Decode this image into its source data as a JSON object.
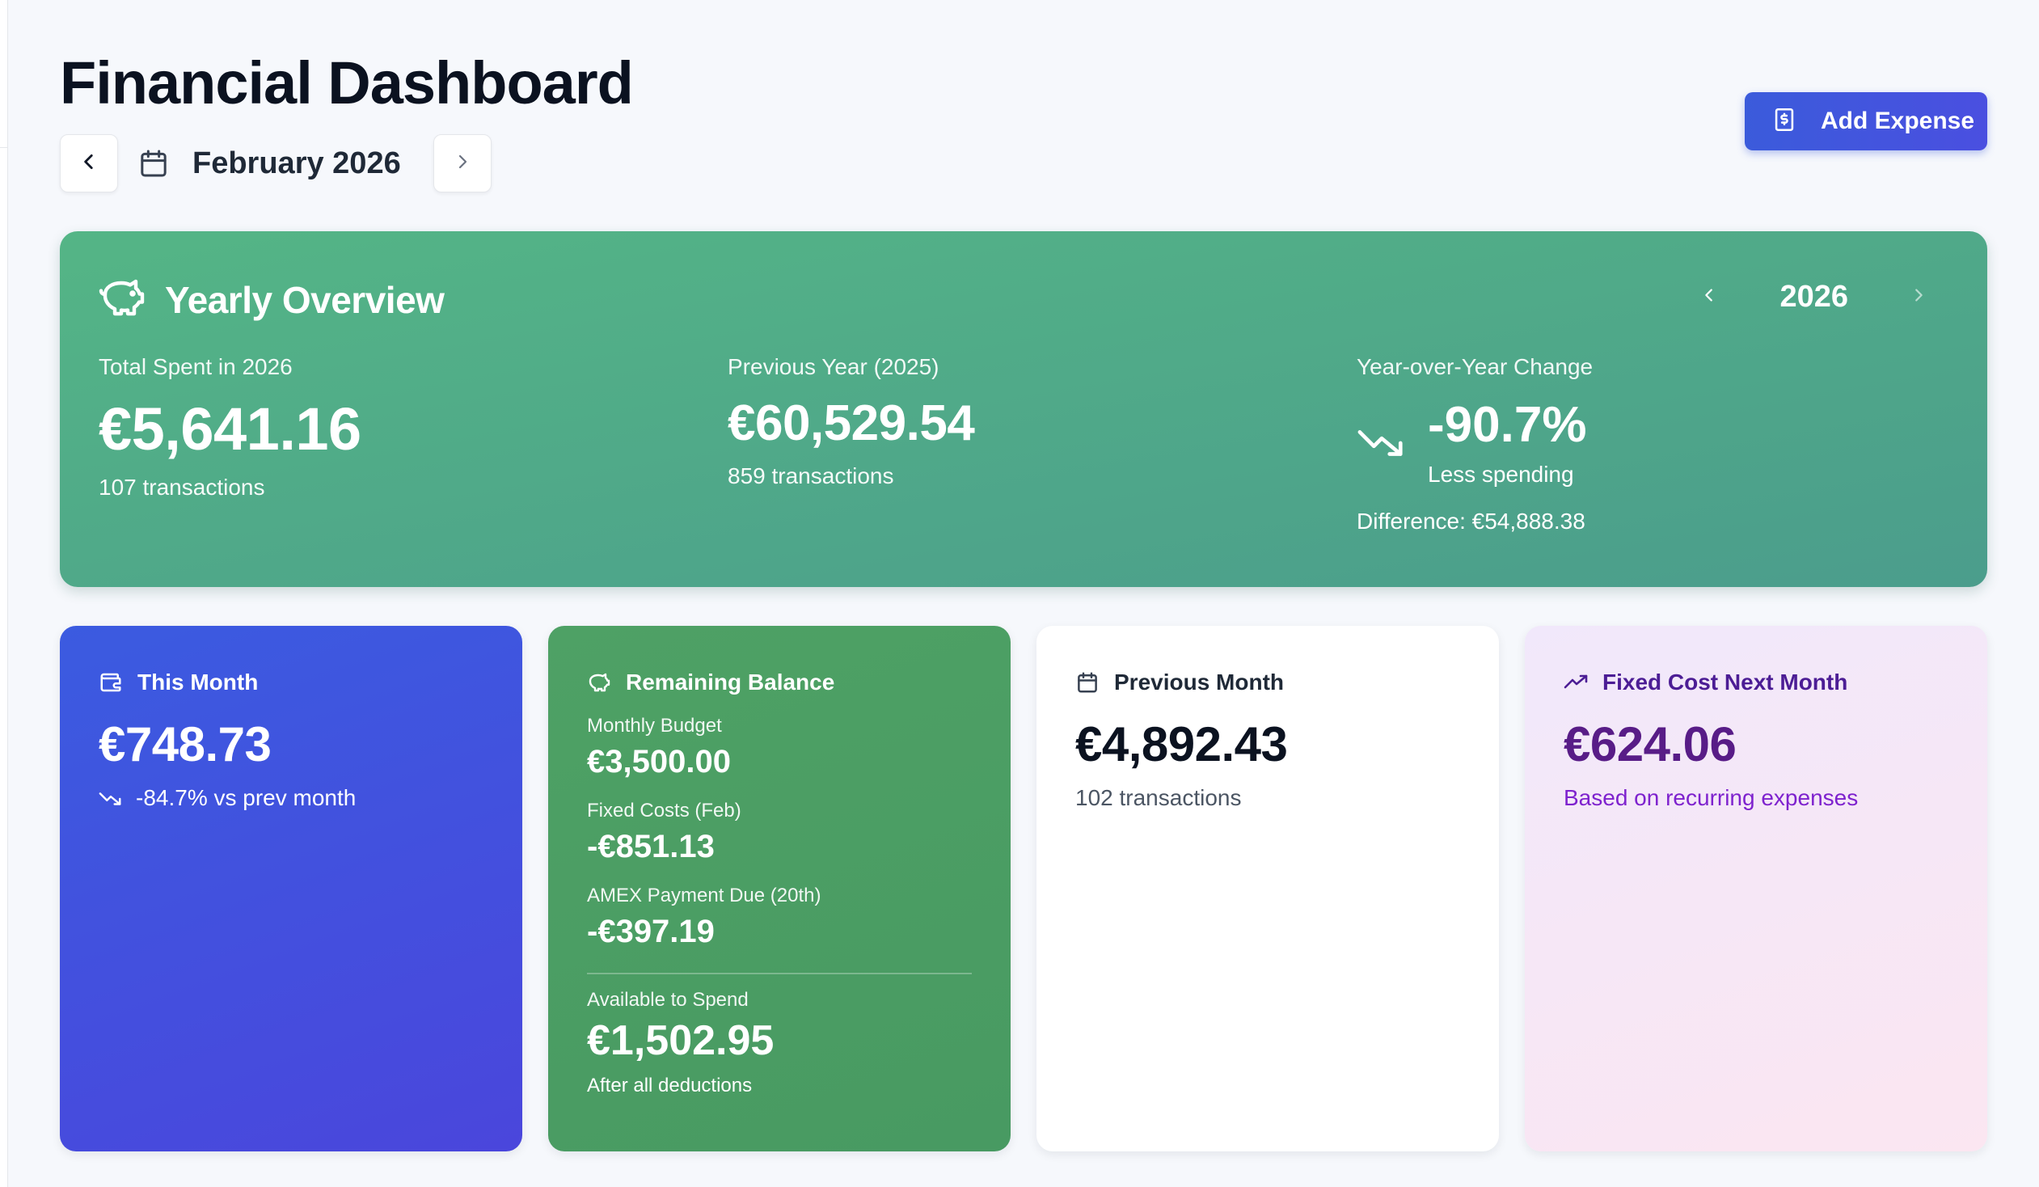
{
  "header": {
    "title": "Financial Dashboard",
    "month": "February 2026",
    "add_label": "Add Expense"
  },
  "yearly": {
    "title": "Yearly Overview",
    "year": "2026",
    "total": {
      "caption": "Total Spent in 2026",
      "amount": "€5,641.16",
      "count": "107 transactions"
    },
    "previous": {
      "caption": "Previous Year (2025)",
      "amount": "€60,529.54",
      "count": "859 transactions"
    },
    "change": {
      "caption": "Year-over-Year Change",
      "pct": "-90.7%",
      "note": "Less spending",
      "difference": "Difference: €54,888.38"
    }
  },
  "cards": {
    "this_month": {
      "title": "This Month",
      "amount": "€748.73",
      "trend": "-84.7% vs prev month"
    },
    "remaining": {
      "title": "Remaining Balance",
      "items": [
        {
          "label": "Monthly Budget",
          "amount": "€3,500.00"
        },
        {
          "label": "Fixed Costs (Feb)",
          "amount": "-€851.13"
        },
        {
          "label": "AMEX Payment Due (20th)",
          "amount": "-€397.19"
        }
      ],
      "available_label": "Available to Spend",
      "available_amount": "€1,502.95",
      "available_note": "After all deductions"
    },
    "previous_month": {
      "title": "Previous Month",
      "amount": "€4,892.43",
      "count": "102 transactions"
    },
    "fixed_next": {
      "title": "Fixed Cost Next Month",
      "amount": "€624.06",
      "note": "Based on recurring expenses"
    }
  },
  "icons": {
    "prev": "chevron-left-icon",
    "next": "chevron-right-icon",
    "calendar": "calendar-icon",
    "add": "receipt-dollar-icon",
    "piggy": "piggy-bank-icon",
    "trend_down": "trending-down-icon",
    "wallet": "wallet-icon",
    "trend_up": "trending-up-icon"
  },
  "colors": {
    "accent": "#3b5bdb",
    "yearly_green": "#54b586",
    "remaining_green": "#4ea165",
    "fixed_purple": "#581c87"
  }
}
